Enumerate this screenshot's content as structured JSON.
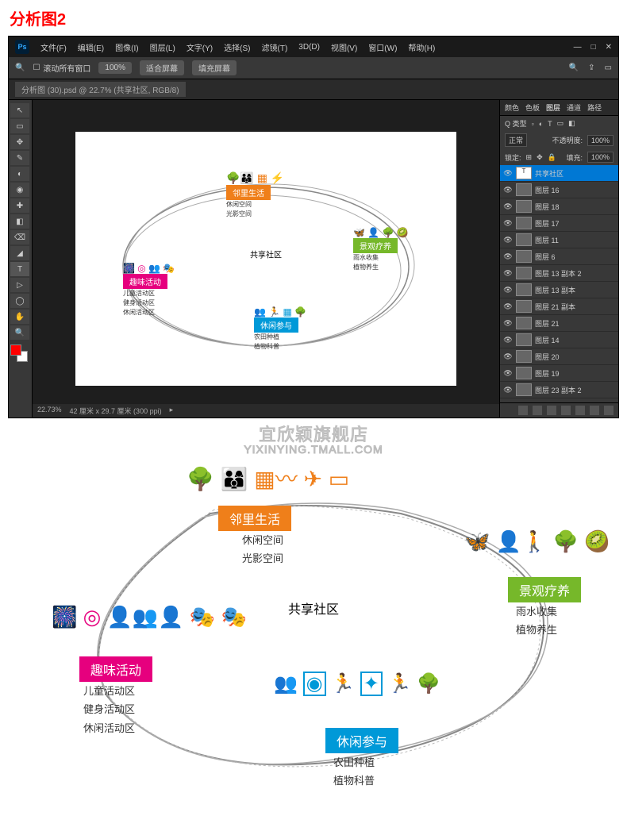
{
  "page_title": "分析图2",
  "ps": {
    "logo": "Ps",
    "menu": [
      "文件(F)",
      "编辑(E)",
      "图像(I)",
      "图层(L)",
      "文字(Y)",
      "选择(S)",
      "滤镜(T)",
      "3D(D)",
      "视图(V)",
      "窗口(W)",
      "帮助(H)"
    ],
    "options": {
      "move_all_windows": "滚动所有窗口",
      "zoom_100": "100%",
      "fit_screen": "适合屏幕",
      "fill_screen": "填充屏幕"
    },
    "tab_title": "分析图 (30).psd @ 22.7% (共享社区, RGB/8)",
    "tools": [
      "↖",
      "▭",
      "✥",
      "✎",
      "◐",
      "◉",
      "✚",
      "◧",
      "⌫",
      "◢",
      "T",
      "▷",
      "◯",
      "✋",
      "🔍"
    ],
    "status": {
      "zoom": "22.73%",
      "doc_size": "42 厘米 x 29.7 厘米 (300 ppi)"
    },
    "panel_tabs": [
      "颜色",
      "色板",
      "图层",
      "通道",
      "路径"
    ],
    "layer_opts": {
      "kind": "Q 类型",
      "mode": "正常",
      "opacity_label": "不透明度:",
      "opacity": "100%",
      "lock_label": "锁定:",
      "fill_label": "填充:",
      "fill": "100%"
    },
    "active_layer": "共享社区",
    "layers": [
      {
        "name": "图层 16",
        "vis": true
      },
      {
        "name": "图层 18",
        "vis": true
      },
      {
        "name": "图层 17",
        "vis": true
      },
      {
        "name": "图层 11",
        "vis": true
      },
      {
        "name": "图层 6",
        "vis": true
      },
      {
        "name": "图层 13 副本 2",
        "vis": true
      },
      {
        "name": "图层 13 副本",
        "vis": true
      },
      {
        "name": "图层 21 副本",
        "vis": true
      },
      {
        "name": "图层 21",
        "vis": true
      },
      {
        "name": "图层 14",
        "vis": true
      },
      {
        "name": "图层 20",
        "vis": true
      },
      {
        "name": "图层 19",
        "vis": true
      },
      {
        "name": "图层 23 副本 2",
        "vis": true
      }
    ]
  },
  "diagram": {
    "center": "共享社区",
    "watermark_cn": "宜欣颖旗舰店",
    "watermark_en": "YIXINYING.TMALL.COM",
    "nodes": {
      "orange": {
        "label": "邻里生活",
        "subs": [
          "休闲空间",
          "光影空间"
        ],
        "color": "#ef7f1a"
      },
      "pink": {
        "label": "趣味活动",
        "subs": [
          "儿童活动区",
          "健身活动区",
          "休闲活动区"
        ],
        "color": "#e6007e"
      },
      "green": {
        "label": "景观疗养",
        "subs": [
          "雨水收集",
          "植物养生"
        ],
        "color": "#76b82a"
      },
      "blue": {
        "label": "休闲参与",
        "subs": [
          "农田种植",
          "植物科普"
        ],
        "color": "#0099d8"
      }
    },
    "small_subs": {
      "orange": [
        "休闲空间",
        "光影空间"
      ],
      "pink": [
        "儿童活动区",
        "健身活动区",
        "休闲活动区"
      ],
      "green": [
        "雨水收集",
        "植物养生"
      ],
      "blue": [
        "农田种植",
        "植物科普"
      ]
    }
  }
}
